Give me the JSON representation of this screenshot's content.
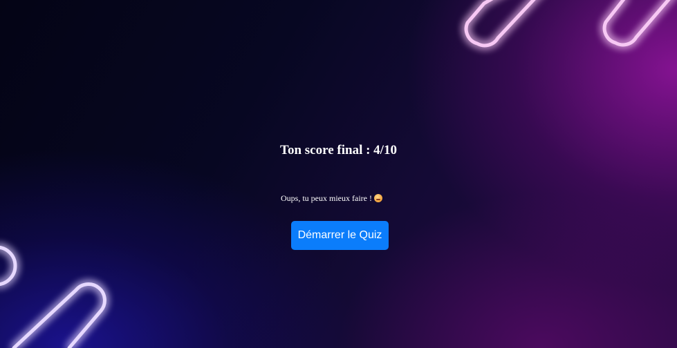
{
  "result": {
    "score_label": "Ton score final : 4/10",
    "message": "Oups, tu peux mieux faire !",
    "message_emoji": "flushed-face-emoji"
  },
  "actions": {
    "start_label": "Démarrer le Quiz"
  },
  "theme": {
    "button_color": "#0b7dfb",
    "neon_pink": "#ff66e8",
    "neon_violet": "#b58cff"
  }
}
